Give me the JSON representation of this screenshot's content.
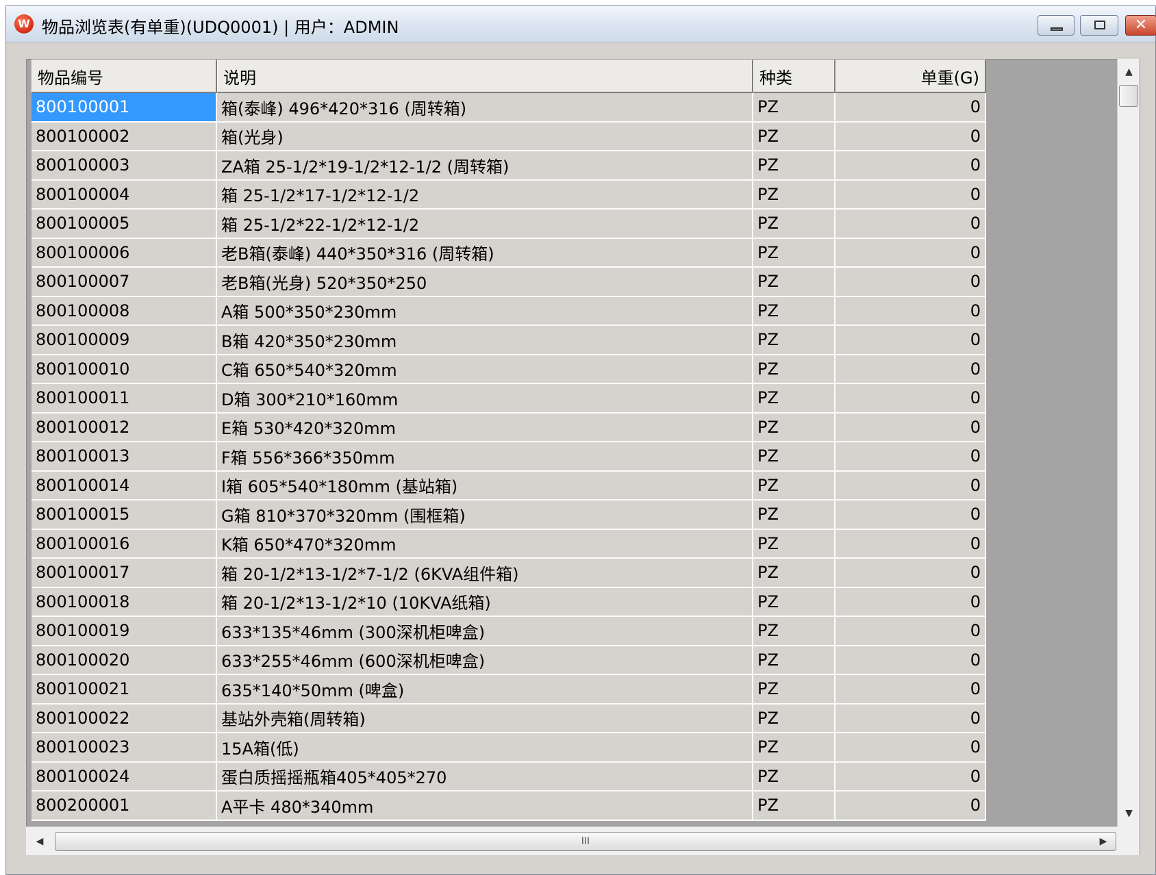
{
  "window": {
    "title": "物品浏览表(有单重)(UDQ0001) | 用户：ADMIN",
    "icon": "app-logo-icon",
    "controls": {
      "minimize": "minimize-icon",
      "maximize": "maximize-icon",
      "close": "close-icon"
    }
  },
  "grid": {
    "columns": [
      "物品编号",
      "说明",
      "种类",
      "单重(G)"
    ],
    "selected_row": 0,
    "rows": [
      [
        "800100001",
        "箱(泰峰)  496*420*316  (周转箱)",
        "PZ",
        "0"
      ],
      [
        "800100002",
        "箱(光身)",
        "PZ",
        "0"
      ],
      [
        "800100003",
        "ZA箱 25-1/2*19-1/2*12-1/2  (周转箱)",
        "PZ",
        "0"
      ],
      [
        "800100004",
        "箱 25-1/2*17-1/2*12-1/2",
        "PZ",
        "0"
      ],
      [
        "800100005",
        "箱 25-1/2*22-1/2*12-1/2",
        "PZ",
        "0"
      ],
      [
        "800100006",
        "老B箱(泰峰) 440*350*316 (周转箱)",
        "PZ",
        "0"
      ],
      [
        "800100007",
        "老B箱(光身) 520*350*250",
        "PZ",
        "0"
      ],
      [
        "800100008",
        "A箱 500*350*230mm",
        "PZ",
        "0"
      ],
      [
        "800100009",
        "B箱 420*350*230mm",
        "PZ",
        "0"
      ],
      [
        "800100010",
        "C箱 650*540*320mm",
        "PZ",
        "0"
      ],
      [
        "800100011",
        "D箱 300*210*160mm",
        "PZ",
        "0"
      ],
      [
        "800100012",
        "E箱 530*420*320mm",
        "PZ",
        "0"
      ],
      [
        "800100013",
        "F箱 556*366*350mm",
        "PZ",
        "0"
      ],
      [
        "800100014",
        "I箱 605*540*180mm (基站箱)",
        "PZ",
        "0"
      ],
      [
        "800100015",
        "G箱 810*370*320mm (围框箱)",
        "PZ",
        "0"
      ],
      [
        "800100016",
        "K箱 650*470*320mm",
        "PZ",
        "0"
      ],
      [
        "800100017",
        "箱 20-1/2*13-1/2*7-1/2 (6KVA组件箱)",
        "PZ",
        "0"
      ],
      [
        "800100018",
        "箱 20-1/2*13-1/2*10 (10KVA纸箱)",
        "PZ",
        "0"
      ],
      [
        "800100019",
        "633*135*46mm  (300深机柜啤盒)",
        "PZ",
        "0"
      ],
      [
        "800100020",
        "633*255*46mm  (600深机柜啤盒)",
        "PZ",
        "0"
      ],
      [
        "800100021",
        "635*140*50mm  (啤盒)",
        "PZ",
        "0"
      ],
      [
        "800100022",
        "基站外壳箱(周转箱)",
        "PZ",
        "0"
      ],
      [
        "800100023",
        "15A箱(低)",
        "PZ",
        "0"
      ],
      [
        "800100024",
        "蛋白质摇摇瓶箱405*405*270",
        "PZ",
        "0"
      ],
      [
        "800200001",
        "A平卡 480*340mm",
        "PZ",
        "0"
      ]
    ]
  },
  "scrollbars": {
    "vertical": {
      "up": "scroll-up-arrow-icon",
      "down": "scroll-down-arrow-icon"
    },
    "horizontal": {
      "left": "scroll-left-arrow-icon",
      "right": "scroll-right-arrow-icon",
      "grip": "III"
    }
  }
}
